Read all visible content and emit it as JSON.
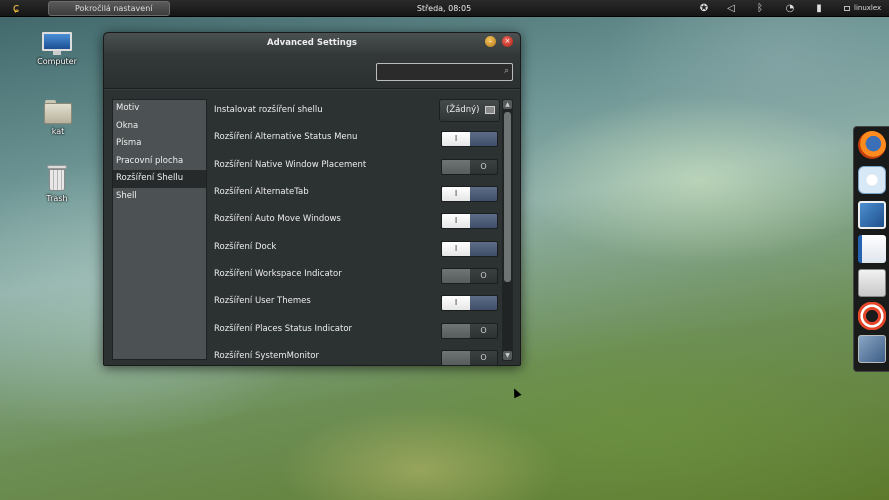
{
  "topbar": {
    "activities_icon": "gnome-foot-icon",
    "app_menu_label": "Pokročilá nastavení",
    "clock": "Středa, 08:05",
    "user": "linuxlex"
  },
  "desktop": {
    "icons": [
      {
        "label": "Computer"
      },
      {
        "label": "kat"
      },
      {
        "label": "Trash"
      }
    ]
  },
  "window": {
    "title": "Advanced Settings",
    "search_placeholder": "",
    "sidebar": [
      {
        "label": "Motiv"
      },
      {
        "label": "Okna"
      },
      {
        "label": "Písma"
      },
      {
        "label": "Pracovní plocha"
      },
      {
        "label": "Rozšíření Shellu",
        "active": true
      },
      {
        "label": "Shell"
      }
    ],
    "install_row": {
      "label": "Instalovat rozšíření shellu",
      "value": "(Žádný)"
    },
    "rows": [
      {
        "label": "Rozšíření Alternative Status Menu",
        "on": true
      },
      {
        "label": "Rozšíření Native Window Placement",
        "on": false
      },
      {
        "label": "Rozšíření AlternateTab",
        "on": true
      },
      {
        "label": "Rozšíření Auto Move Windows",
        "on": true
      },
      {
        "label": "Rozšíření Dock",
        "on": true
      },
      {
        "label": "Rozšíření Workspace Indicator",
        "on": false
      },
      {
        "label": "Rozšíření User Themes",
        "on": true
      },
      {
        "label": "Rozšíření Places Status Indicator",
        "on": false
      },
      {
        "label": "Rozšíření SystemMonitor",
        "on": false
      }
    ],
    "switch_on_glyph": "I",
    "switch_off_glyph": "O"
  },
  "dock": [
    "firefox-icon",
    "empathy-icon",
    "shotwell-icon",
    "libreoffice-writer-icon",
    "file-manager-icon",
    "help-icon",
    "system-tools-icon"
  ]
}
